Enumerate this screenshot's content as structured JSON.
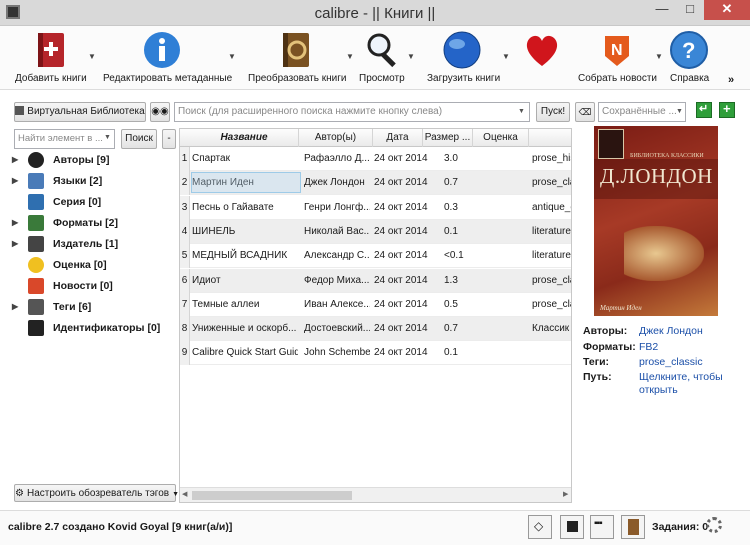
{
  "window": {
    "title": "calibre - || Книги ||",
    "minimize": "—",
    "maximize": "□",
    "close": "✕"
  },
  "toolbar": {
    "add_books": "Добавить книги",
    "edit_metadata": "Редактировать метаданные",
    "convert_books": "Преобразовать книги",
    "view": "Просмотр",
    "send_to_device": "Загрузить книги",
    "fetch_news": "Собрать новости",
    "help": "Справка",
    "more": "»"
  },
  "search_bar": {
    "virtual_library": "Виртуальная Библиотека",
    "search_placeholder": "Поиск (для расширенного поиска нажмите кнопку слева)",
    "go_button": "Пуск!",
    "saved_searches_placeholder": "Сохранённые ..."
  },
  "tag_browser": {
    "find_placeholder": "Найти элемент в ...",
    "find_button": "Поиск",
    "collapse_button": "-",
    "items": [
      {
        "label": "Авторы [9]",
        "icon": "user-icon",
        "expandable": true
      },
      {
        "label": "Языки [2]",
        "icon": "languages-icon",
        "expandable": true
      },
      {
        "label": "Серия [0]",
        "icon": "series-icon",
        "expandable": false
      },
      {
        "label": "Форматы [2]",
        "icon": "formats-icon",
        "expandable": true
      },
      {
        "label": "Издатель [1]",
        "icon": "publisher-icon",
        "expandable": true
      },
      {
        "label": "Оценка [0]",
        "icon": "star-icon",
        "expandable": false
      },
      {
        "label": "Новости [0]",
        "icon": "news-icon",
        "expandable": false
      },
      {
        "label": "Теги [6]",
        "icon": "tag-icon",
        "expandable": true
      },
      {
        "label": "Идентификаторы [0]",
        "icon": "barcode-icon",
        "expandable": false
      }
    ],
    "configure_button": "Настроить обозреватель тэгов"
  },
  "book_table": {
    "columns": [
      "Название",
      "Автор(ы)",
      "Дата",
      "Размер ...",
      "Оценка",
      ""
    ],
    "rows": [
      {
        "num": "1",
        "title": "Спартак",
        "author": "Рафаэлло Д...",
        "date": "24 окт 2014",
        "size": "3.0",
        "rating": "",
        "tags": "prose_his"
      },
      {
        "num": "2",
        "title": "Мартин Иден",
        "author": "Джек Лондон",
        "date": "24 окт 2014",
        "size": "0.7",
        "rating": "",
        "tags": "prose_clas"
      },
      {
        "num": "3",
        "title": "Песнь о Гайавате",
        "author": "Генри Лонгф...",
        "date": "24 окт 2014",
        "size": "0.3",
        "rating": "",
        "tags": "antique_c"
      },
      {
        "num": "4",
        "title": "ШИНЕЛЬ",
        "author": "Николай Вас...",
        "date": "24 окт 2014",
        "size": "0.1",
        "rating": "",
        "tags": "literature"
      },
      {
        "num": "5",
        "title": "МЕДНЫЙ ВСАДНИК",
        "author": "Александр С...",
        "date": "24 окт 2014",
        "size": "<0.1",
        "rating": "",
        "tags": "literature"
      },
      {
        "num": "6",
        "title": "Идиот",
        "author": "Федор Миха...",
        "date": "24 окт 2014",
        "size": "1.3",
        "rating": "",
        "tags": "prose_clas"
      },
      {
        "num": "7",
        "title": "Темные аллеи",
        "author": "Иван Алексе...",
        "date": "24 окт 2014",
        "size": "0.5",
        "rating": "",
        "tags": "prose_clas"
      },
      {
        "num": "8",
        "title": "Униженные и оскорб...",
        "author": "Достоевский...",
        "date": "24 окт 2014",
        "size": "0.7",
        "rating": "",
        "tags": "Классик"
      },
      {
        "num": "9",
        "title": "Calibre Quick Start Guide",
        "author": "John Schember",
        "date": "24 окт 2014",
        "size": "0.1",
        "rating": "",
        "tags": ""
      }
    ]
  },
  "cover": {
    "series_text": "БИБЛИОТЕКА КЛАССИКИ",
    "author_text": "Д.ЛОНДОН",
    "book_text": "Мартин Иден"
  },
  "details": {
    "authors_label": "Авторы:",
    "authors_value": "Джек Лондон",
    "formats_label": "Форматы:",
    "formats_value": "FB2",
    "tags_label": "Теги:",
    "tags_value": "prose_classic",
    "path_label": "Путь:",
    "path_value_line1": "Щелкните, чтобы",
    "path_value_line2": "открыть"
  },
  "status_bar": {
    "left": "calibre 2.7 создано Kovid Goyal  [9 книг(а/и)]",
    "jobs": "Задания: 0"
  },
  "colors": {
    "accent_link": "#1b4fa8",
    "close_button": "#c7504b",
    "cover_red": "#a73a26"
  }
}
